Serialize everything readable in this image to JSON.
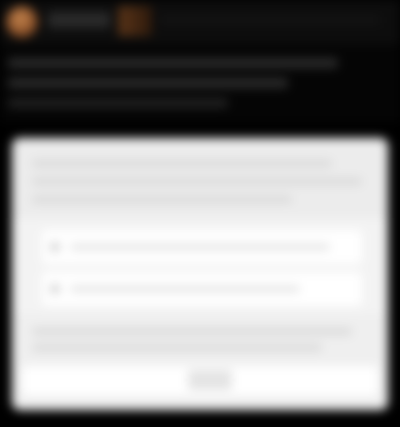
{
  "header": {
    "avatar_icon": "user-avatar-icon",
    "accent_color": "#8a5028"
  },
  "title_band": {},
  "card": {
    "rows": [
      {
        "icon": "bullet-icon"
      },
      {
        "icon": "bullet-icon"
      }
    ],
    "background_color": "#f3f3f3"
  },
  "page": {
    "background_color": "#000000",
    "note_visible_text": ""
  }
}
